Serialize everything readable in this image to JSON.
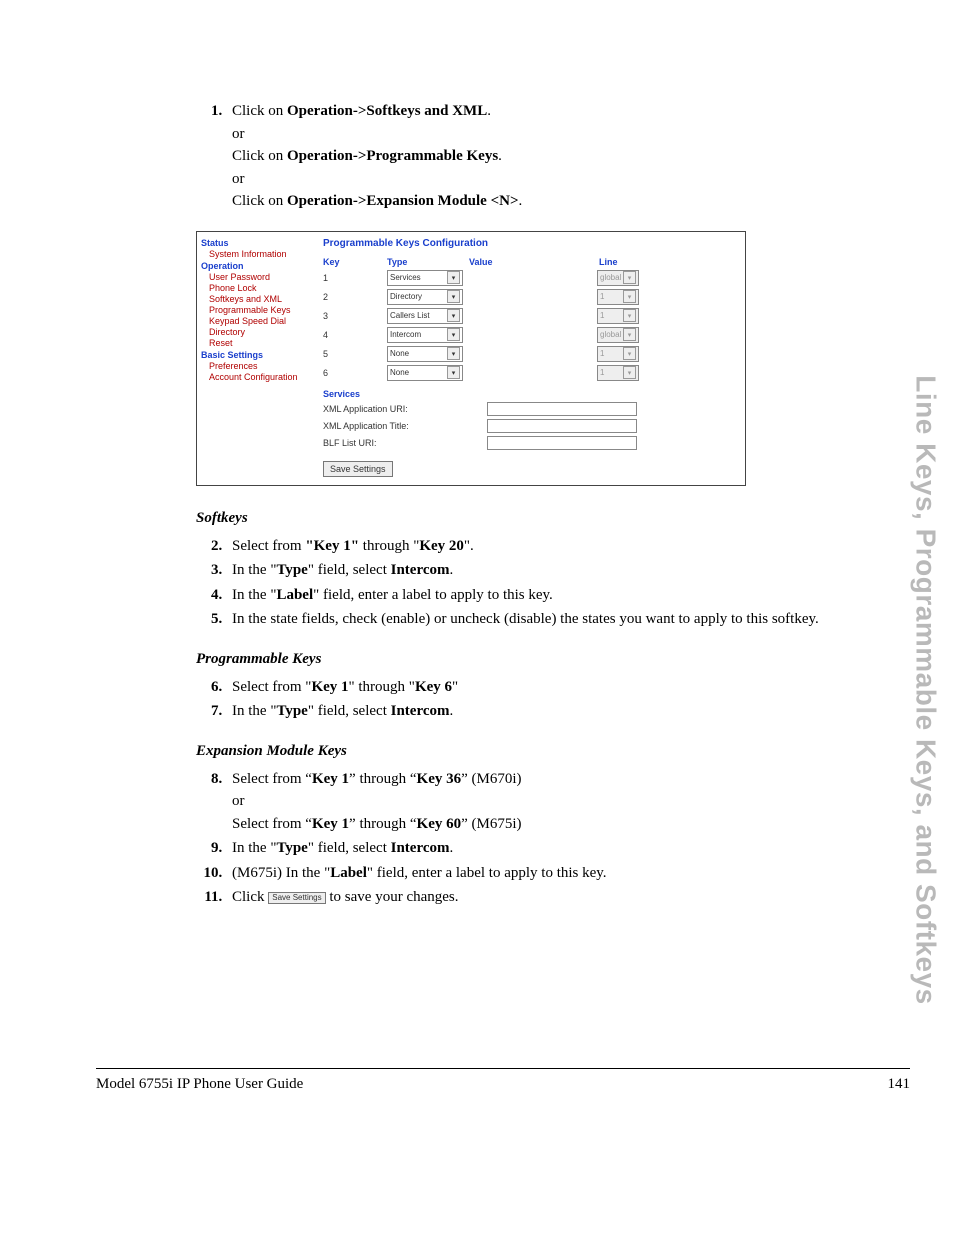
{
  "steps": {
    "s1a": "Click on ",
    "s1a_bold": "Operation->Softkeys and XML",
    "s1_or": "or",
    "s1b": "Click on ",
    "s1b_bold": "Operation->Programmable Keys",
    "s1c": "Click on ",
    "s1c_bold": "Operation->Expansion Module <N>",
    "s2a": "Select from ",
    "s2b": "\"Key 1\"",
    "s2c": " through \"",
    "s2d": "Key 20",
    "s2e": "\".",
    "s3a": "In the \"",
    "s3b": "Type",
    "s3c": "\" field, select ",
    "s3d": "Intercom",
    "s3dot": ".",
    "s4a": "In the \"",
    "s4b": "Label",
    "s4c": "\" field, enter a label to apply to this key.",
    "s5": "In the state fields, check (enable) or uncheck (disable) the states you want to apply to this softkey.",
    "s6a": "Select from \"",
    "s6b": "Key 1",
    "s6c": "\" through \"",
    "s6d": "Key 6",
    "s6e": "\"",
    "s8a": "Select from “",
    "s8b": "Key 1",
    "s8c": "” through “",
    "s8d": "Key 36",
    "s8e": "” (M670i)",
    "s8f": "Select from “",
    "s8g": "Key 1",
    "s8h": "” through “",
    "s8i": "Key 60",
    "s8j": "” (M675i)",
    "s10a": "(M675i) In the \"",
    "s10b": "Label",
    "s10c": "\" field, enter a label to apply to this key.",
    "s11a": "Click ",
    "s11btn": "Save Settings",
    "s11b": " to save your changes."
  },
  "subheads": {
    "softkeys": "Softkeys",
    "progkeys": "Programmable Keys",
    "expmod": "Expansion Module Keys"
  },
  "figure": {
    "nav": {
      "status": "Status",
      "sysinfo": "System Information",
      "operation": "Operation",
      "userpw": "User Password",
      "phonelock": "Phone Lock",
      "softxml": "Softkeys and XML",
      "progkeys": "Programmable Keys",
      "keypad": "Keypad Speed Dial",
      "directory": "Directory",
      "reset": "Reset",
      "basic": "Basic Settings",
      "pref": "Preferences",
      "acct": "Account Configuration"
    },
    "title": "Programmable Keys Configuration",
    "columns": {
      "key": "Key",
      "type": "Type",
      "value": "Value",
      "line": "Line"
    },
    "rows": [
      {
        "key": "1",
        "type": "Services",
        "line": "global",
        "typeDisabled": false,
        "lineDisabled": true
      },
      {
        "key": "2",
        "type": "Directory",
        "line": "1",
        "typeDisabled": false,
        "lineDisabled": true
      },
      {
        "key": "3",
        "type": "Callers List",
        "line": "1",
        "typeDisabled": false,
        "lineDisabled": true
      },
      {
        "key": "4",
        "type": "Intercom",
        "line": "global",
        "typeDisabled": false,
        "lineDisabled": true
      },
      {
        "key": "5",
        "type": "None",
        "line": "1",
        "typeDisabled": false,
        "lineDisabled": true
      },
      {
        "key": "6",
        "type": "None",
        "line": "1",
        "typeDisabled": false,
        "lineDisabled": true
      }
    ],
    "services": {
      "header": "Services",
      "xmluri": "XML Application URI:",
      "xmltitle": "XML Application Title:",
      "blf": "BLF List URI:"
    },
    "save": "Save Settings"
  },
  "sidebar": "Line Keys, Programmable Keys, and Softkeys",
  "footer": {
    "left": "Model 6755i IP Phone User Guide",
    "right": "141"
  }
}
